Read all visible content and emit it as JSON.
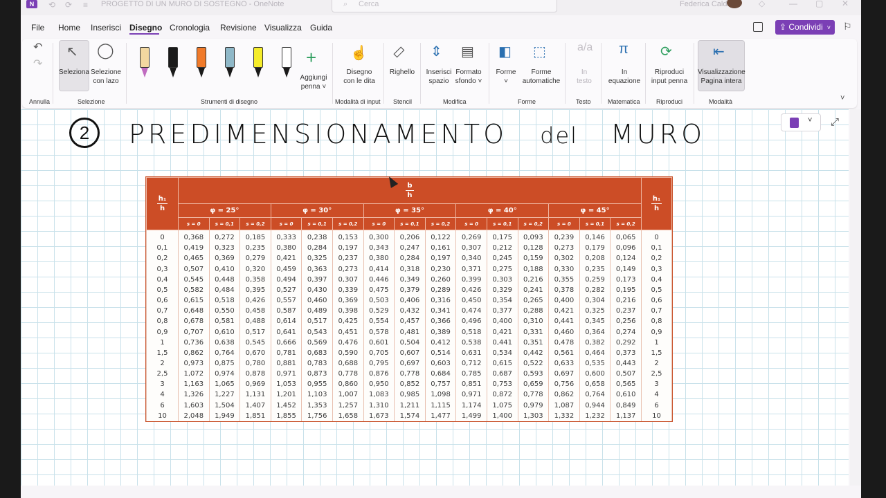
{
  "titlebar": {
    "app_icon": "N",
    "document_title": "PROGETTO DI UN MURO DI SOSTEGNO  -  OneNote",
    "search_placeholder": "Cerca",
    "user_name": "Federica Caldi"
  },
  "menu": {
    "items": [
      "File",
      "Home",
      "Inserisci",
      "Disegno",
      "Cronologia",
      "Revisione",
      "Visualizza",
      "Guida"
    ],
    "active": "Disegno",
    "share_label": "Condividi"
  },
  "ribbon": {
    "groups": {
      "undo": "Annulla",
      "selection": "Selezione",
      "drawing_tools": "Strumenti di disegno",
      "input_mode": "Modalità di input",
      "stencils": "Stencil",
      "modify": "Modifica",
      "shapes": "Forme",
      "text": "Testo",
      "math": "Matematica",
      "replay": "Riproduci",
      "mode": "Modalità"
    },
    "buttons": {
      "select": "Seleziona",
      "lasso_1": "Selezione",
      "lasso_2": "con lazo",
      "add_pen_1": "Aggiungi",
      "add_pen_2": "penna ˅",
      "finger_1": "Disegno",
      "finger_2": "con le dita",
      "ruler": "Righello",
      "insert_space_1": "Inserisci",
      "insert_space_2": "spazio",
      "background_1": "Formato",
      "background_2": "sfondo ˅",
      "shapes": "Forme",
      "autoshapes_1": "Forme",
      "autoshapes_2": "automatiche",
      "to_text_1": "In",
      "to_text_2": "testo",
      "to_math_1": "In",
      "to_math_2": "equazione",
      "replay_1": "Riproduci",
      "replay_2": "input penna",
      "fullpage_1": "Visualizzazione",
      "fullpage_2": "Pagina intera"
    },
    "pens": [
      {
        "color": "#f2d7a0",
        "tip": "#c06bc0"
      },
      {
        "color": "#1a1a1a",
        "tip": "#1a1a1a"
      },
      {
        "color": "#f07a2a",
        "tip": "#1a1a1a"
      },
      {
        "color": "#8fb8c8",
        "tip": "#1a1a1a"
      },
      {
        "color": "#f5ec2a",
        "tip": "#1a1a1a"
      },
      {
        "color": "#ffffff",
        "tip": "#1a1a1a"
      }
    ]
  },
  "page": {
    "number": "2",
    "heading_upper": "PREDIMENSIONAMENTO",
    "heading_del": "del",
    "heading_muro": "MURO"
  },
  "table": {
    "h1h_top": "h₁",
    "h1h_bottom": "h",
    "bh_top": "b",
    "bh_bottom": "h",
    "phi_headers": [
      "φ = 25°",
      "φ = 30°",
      "φ = 35°",
      "φ = 40°",
      "φ = 45°"
    ],
    "s_headers": [
      "s = 0",
      "s = 0,1",
      "s = 0,2"
    ],
    "rows": [
      {
        "h": "0",
        "v": [
          "0,368",
          "0,272",
          "0,185",
          "0,333",
          "0,238",
          "0,153",
          "0,300",
          "0,206",
          "0,122",
          "0,269",
          "0,175",
          "0,093",
          "0,239",
          "0,146",
          "0,065"
        ]
      },
      {
        "h": "0,1",
        "v": [
          "0,419",
          "0,323",
          "0,235",
          "0,380",
          "0,284",
          "0,197",
          "0,343",
          "0,247",
          "0,161",
          "0,307",
          "0,212",
          "0,128",
          "0,273",
          "0,179",
          "0,096"
        ]
      },
      {
        "h": "0,2",
        "v": [
          "0,465",
          "0,369",
          "0,279",
          "0,421",
          "0,325",
          "0,237",
          "0,380",
          "0,284",
          "0,197",
          "0,340",
          "0,245",
          "0,159",
          "0,302",
          "0,208",
          "0,124"
        ]
      },
      {
        "h": "0,3",
        "v": [
          "0,507",
          "0,410",
          "0,320",
          "0,459",
          "0,363",
          "0,273",
          "0,414",
          "0,318",
          "0,230",
          "0,371",
          "0,275",
          "0,188",
          "0,330",
          "0,235",
          "0,149"
        ]
      },
      {
        "h": "0,4",
        "v": [
          "0,545",
          "0,448",
          "0,358",
          "0,494",
          "0,397",
          "0,307",
          "0,446",
          "0,349",
          "0,260",
          "0,399",
          "0,303",
          "0,216",
          "0,355",
          "0,259",
          "0,173"
        ]
      },
      {
        "h": "0,5",
        "v": [
          "0,582",
          "0,484",
          "0,395",
          "0,527",
          "0,430",
          "0,339",
          "0,475",
          "0,379",
          "0,289",
          "0,426",
          "0,329",
          "0,241",
          "0,378",
          "0,282",
          "0,195"
        ]
      },
      {
        "h": "0,6",
        "v": [
          "0,615",
          "0,518",
          "0,426",
          "0,557",
          "0,460",
          "0,369",
          "0,503",
          "0,406",
          "0,316",
          "0,450",
          "0,354",
          "0,265",
          "0,400",
          "0,304",
          "0,216"
        ]
      },
      {
        "h": "0,7",
        "v": [
          "0,648",
          "0,550",
          "0,458",
          "0,587",
          "0,489",
          "0,398",
          "0,529",
          "0,432",
          "0,341",
          "0,474",
          "0,377",
          "0,288",
          "0,421",
          "0,325",
          "0,237"
        ]
      },
      {
        "h": "0,8",
        "v": [
          "0,678",
          "0,581",
          "0,488",
          "0,614",
          "0,517",
          "0,425",
          "0,554",
          "0,457",
          "0,366",
          "0,496",
          "0,400",
          "0,310",
          "0,441",
          "0,345",
          "0,256"
        ]
      },
      {
        "h": "0,9",
        "v": [
          "0,707",
          "0,610",
          "0,517",
          "0,641",
          "0,543",
          "0,451",
          "0,578",
          "0,481",
          "0,389",
          "0,518",
          "0,421",
          "0,331",
          "0,460",
          "0,364",
          "0,274"
        ]
      },
      {
        "h": "1",
        "v": [
          "0,736",
          "0,638",
          "0,545",
          "0,666",
          "0,569",
          "0,476",
          "0,601",
          "0,504",
          "0,412",
          "0,538",
          "0,441",
          "0,351",
          "0,478",
          "0,382",
          "0,292"
        ]
      },
      {
        "h": "1,5",
        "v": [
          "0,862",
          "0,764",
          "0,670",
          "0,781",
          "0,683",
          "0,590",
          "0,705",
          "0,607",
          "0,514",
          "0,631",
          "0,534",
          "0,442",
          "0,561",
          "0,464",
          "0,373"
        ]
      },
      {
        "h": "2",
        "v": [
          "0,973",
          "0,875",
          "0,780",
          "0,881",
          "0,783",
          "0,688",
          "0,795",
          "0,697",
          "0,603",
          "0,712",
          "0,615",
          "0,522",
          "0,633",
          "0,535",
          "0,443"
        ]
      },
      {
        "h": "2,5",
        "v": [
          "1,072",
          "0,974",
          "0,878",
          "0,971",
          "0,873",
          "0,778",
          "0,876",
          "0,778",
          "0,684",
          "0,785",
          "0,687",
          "0,593",
          "0,697",
          "0,600",
          "0,507"
        ]
      },
      {
        "h": "3",
        "v": [
          "1,163",
          "1,065",
          "0,969",
          "1,053",
          "0,955",
          "0,860",
          "0,950",
          "0,852",
          "0,757",
          "0,851",
          "0,753",
          "0,659",
          "0,756",
          "0,658",
          "0,565"
        ]
      },
      {
        "h": "4",
        "v": [
          "1,326",
          "1,227",
          "1,131",
          "1,201",
          "1,103",
          "1,007",
          "1,083",
          "0,985",
          "1,098",
          "0,971",
          "0,872",
          "0,778",
          "0,862",
          "0,764",
          "0,610"
        ]
      },
      {
        "h": "6",
        "v": [
          "1,603",
          "1,504",
          "1,407",
          "1,452",
          "1,353",
          "1,257",
          "1,310",
          "1,211",
          "1,115",
          "1,174",
          "1,075",
          "0,979",
          "1,087",
          "0,944",
          "0,849"
        ]
      },
      {
        "h": "10",
        "v": [
          "2,048",
          "1,949",
          "1,851",
          "1,855",
          "1,756",
          "1,658",
          "1,673",
          "1,574",
          "1,477",
          "1,499",
          "1,400",
          "1,303",
          "1,332",
          "1,232",
          "1,137"
        ]
      }
    ]
  }
}
